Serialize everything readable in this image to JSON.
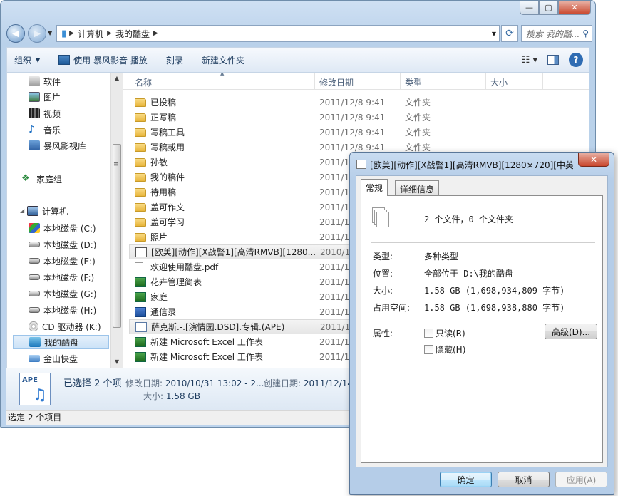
{
  "explorer": {
    "window_controls": {
      "minimize": "—",
      "maximize": "▢",
      "close": "✕"
    },
    "address_crumbs": [
      "计算机",
      "我的酷盘"
    ],
    "search_placeholder": "搜索 我的酷...",
    "toolbar": {
      "organize": "组织",
      "play_with": "使用 暴风影音 播放",
      "burn": "刻录",
      "new_folder": "新建文件夹"
    },
    "nav": {
      "items": [
        {
          "label": "软件",
          "icon": "software-icon"
        },
        {
          "label": "图片",
          "icon": "pictures-icon"
        },
        {
          "label": "视频",
          "icon": "videos-icon"
        },
        {
          "label": "音乐",
          "icon": "music-icon"
        },
        {
          "label": "暴风影视库",
          "icon": "library-icon"
        },
        {
          "label": "家庭组",
          "icon": "homegroup-icon"
        },
        {
          "label": "计算机",
          "icon": "computer-icon"
        },
        {
          "label": "本地磁盘 (C:)",
          "icon": "windows-drive-icon"
        },
        {
          "label": "本地磁盘 (D:)",
          "icon": "hard-drive-icon"
        },
        {
          "label": "本地磁盘 (E:)",
          "icon": "hard-drive-icon"
        },
        {
          "label": "本地磁盘 (F:)",
          "icon": "hard-drive-icon"
        },
        {
          "label": "本地磁盘 (G:)",
          "icon": "hard-drive-icon"
        },
        {
          "label": "本地磁盘 (H:)",
          "icon": "hard-drive-icon"
        },
        {
          "label": "CD 驱动器 (K:)",
          "icon": "cd-drive-icon"
        },
        {
          "label": "我的酷盘",
          "icon": "kuaipan-icon"
        },
        {
          "label": "金山快盘",
          "icon": "jinshan-drive-icon"
        }
      ]
    },
    "columns": {
      "name": "名称",
      "modified": "修改日期",
      "type": "类型",
      "size": "大小"
    },
    "files": [
      {
        "name": "已投稿",
        "date": "2011/12/8 9:41",
        "type": "文件夹",
        "kind": "folder"
      },
      {
        "name": "正写稿",
        "date": "2011/12/8 9:41",
        "type": "文件夹",
        "kind": "folder"
      },
      {
        "name": "写稿工具",
        "date": "2011/12/8 9:41",
        "type": "文件夹",
        "kind": "folder"
      },
      {
        "name": "写稿或用",
        "date": "2011/12/8 9:41",
        "type": "文件夹",
        "kind": "folder"
      },
      {
        "name": "孙敏",
        "date": "2011/12",
        "type": "",
        "kind": "folder"
      },
      {
        "name": "我的稿件",
        "date": "2011/12",
        "type": "",
        "kind": "folder"
      },
      {
        "name": "待用稿",
        "date": "2011/12",
        "type": "",
        "kind": "folder"
      },
      {
        "name": "盖可作文",
        "date": "2011/12",
        "type": "",
        "kind": "folder"
      },
      {
        "name": "盖可学习",
        "date": "2011/12",
        "type": "",
        "kind": "folder"
      },
      {
        "name": "照片",
        "date": "2011/12",
        "type": "",
        "kind": "folder"
      },
      {
        "name": "[欧美][动作][X战警1][高清RMVB][1280...",
        "date": "2010/10",
        "type": "",
        "kind": "rmvb"
      },
      {
        "name": "欢迎使用酷盘.pdf",
        "date": "2011/11",
        "type": "",
        "kind": "pdf"
      },
      {
        "name": "花卉管理简表",
        "date": "2011/11",
        "type": "",
        "kind": "xls"
      },
      {
        "name": "家庭",
        "date": "2011/10",
        "type": "",
        "kind": "xls"
      },
      {
        "name": "通信录",
        "date": "2011/10",
        "type": "",
        "kind": "doc"
      },
      {
        "name": "萨克斯.-.[演情园.DSD].专辑.(APE)",
        "date": "2011/12",
        "type": "",
        "kind": "ape"
      },
      {
        "name": "新建 Microsoft Excel 工作表",
        "date": "2011/11",
        "type": "",
        "kind": "xls"
      },
      {
        "name": "新建 Microsoft Excel 工作表",
        "date": "2011/11",
        "type": "",
        "kind": "xls"
      }
    ],
    "details": {
      "icon_label": "APE",
      "selected": "已选择 2 个项",
      "modified_label": "修改日期:",
      "modified_value": "2010/10/31 13:02 - 2...",
      "created_label": "创建日期:",
      "created_value": "2011/12/14",
      "size_label": "大小:",
      "size_value": "1.58 GB"
    },
    "status": "选定 2 个项目"
  },
  "dialog": {
    "title": "[欧美][动作][X战警1][高清RMVB][1280×720][中英...",
    "close": "✕",
    "tabs": [
      "常规",
      "详细信息"
    ],
    "summary": "2 个文件，0 个文件夹",
    "props": [
      {
        "label": "类型:",
        "value": "多种类型"
      },
      {
        "label": "位置:",
        "value": "全部位于 D:\\我的酷盘"
      },
      {
        "label": "大小:",
        "value": "1.58 GB (1,698,934,809 字节)"
      },
      {
        "label": "占用空间:",
        "value": "1.58 GB (1,698,938,880 字节)"
      }
    ],
    "attributes_label": "属性:",
    "readonly": "只读(R)",
    "hidden": "隐藏(H)",
    "advanced": "高级(D)...",
    "ok": "确定",
    "cancel": "取消",
    "apply": "应用(A)"
  }
}
